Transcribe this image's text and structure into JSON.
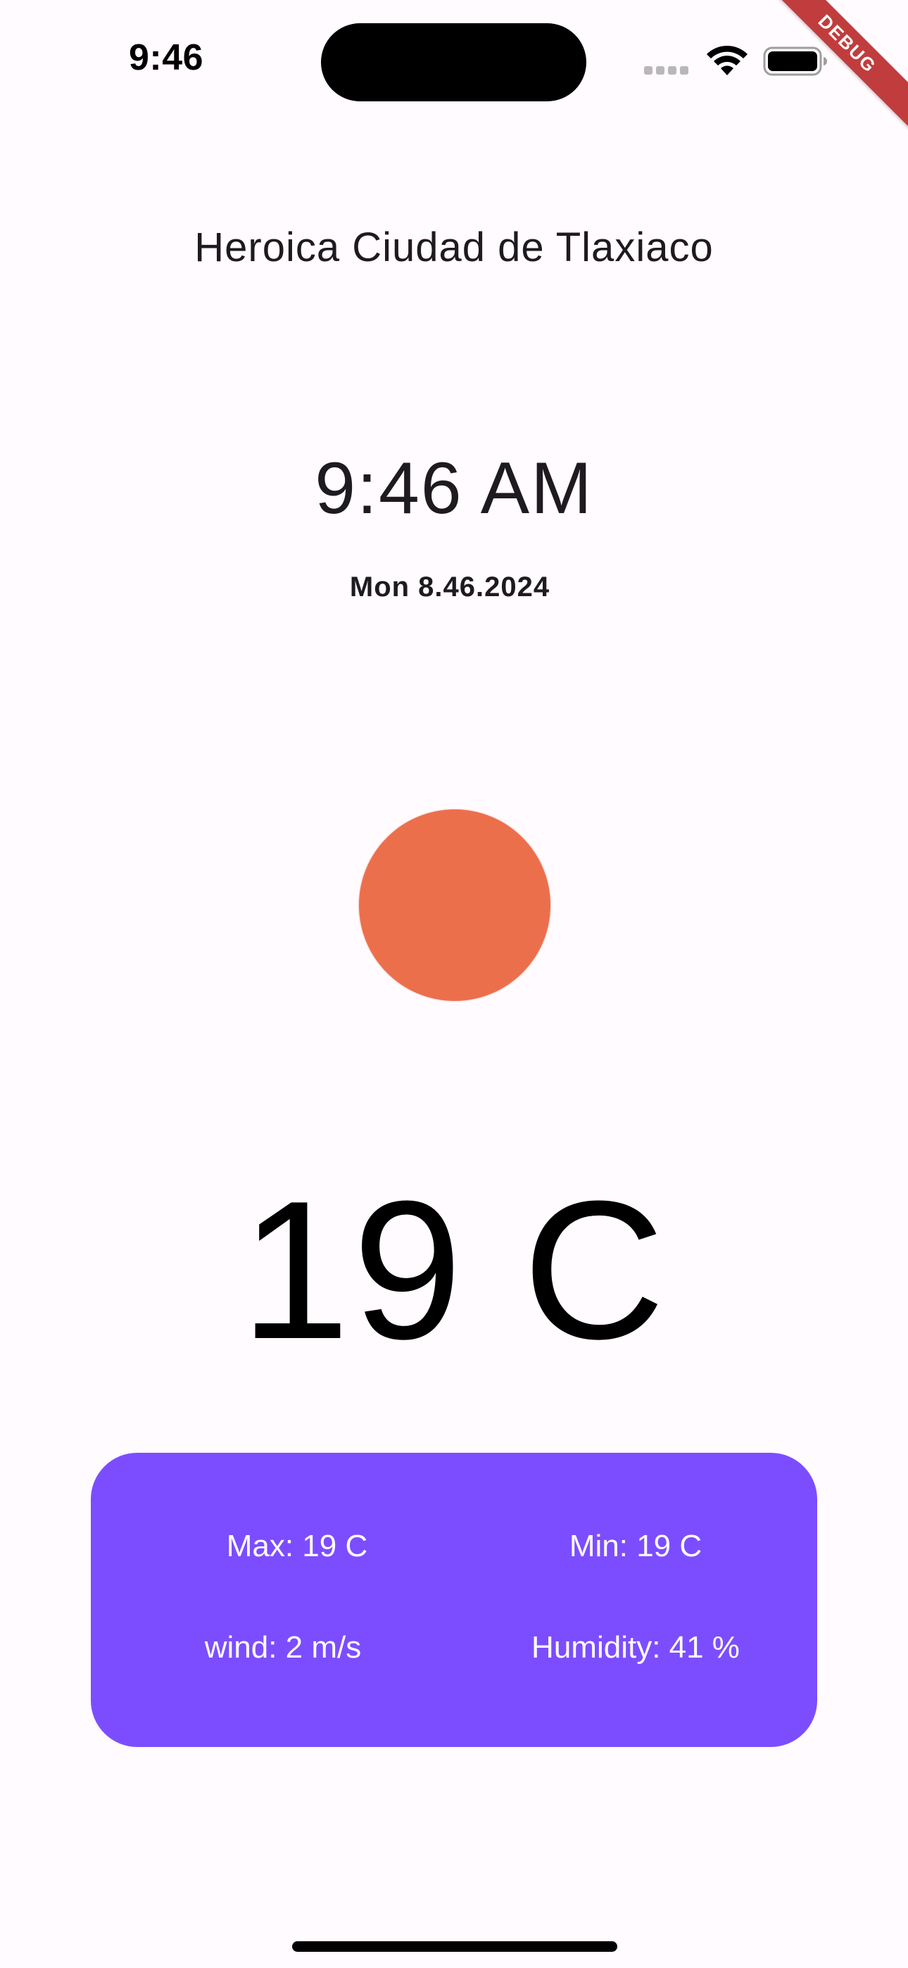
{
  "status_bar": {
    "time": "9:46",
    "icons": [
      "cellular-signal-icon",
      "wifi-icon",
      "battery-icon"
    ]
  },
  "debug_banner": "DEBUG",
  "weather": {
    "city": "Heroica Ciudad de Tlaxiaco",
    "time": "9:46 AM",
    "date": "Mon 8.46.2024",
    "condition_icon_color": "#ec6f4c",
    "temperature": "19 C",
    "details": {
      "max": "Max: 19 C",
      "min": "Min: 19 C",
      "wind": "wind: 2 m/s",
      "humidity": "Humidity: 41 %"
    },
    "card_color": "#7c4dff"
  }
}
